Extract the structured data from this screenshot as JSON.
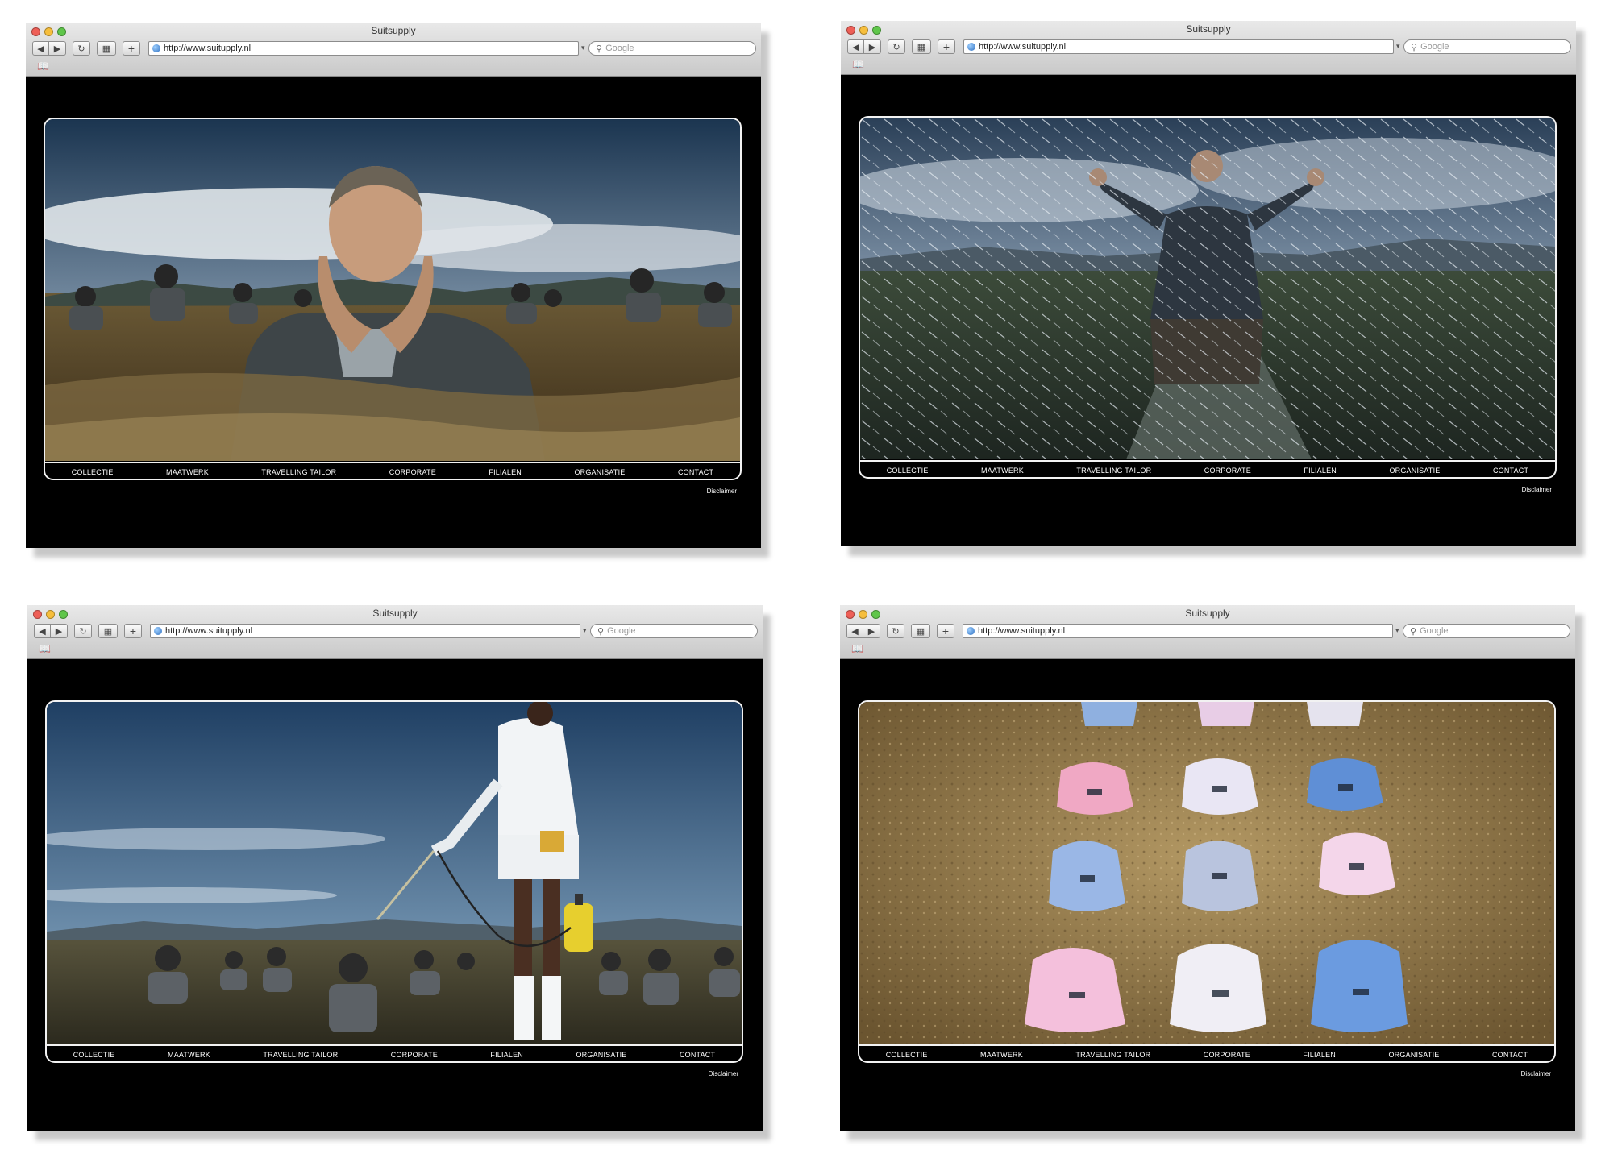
{
  "browser": {
    "title": "Suitsupply",
    "url": "http://www.suitupply.nl",
    "search_placeholder": "Google"
  },
  "site": {
    "nav": [
      "COLLECTIE",
      "MAATWERK",
      "TRAVELLING TAILOR",
      "CORPORATE",
      "FILIALEN",
      "ORGANISATIE",
      "CONTACT"
    ],
    "disclaimer": "Disclaimer"
  },
  "icons": {
    "back": "back-arrow-icon",
    "forward": "forward-arrow-icon",
    "reload": "reload-icon",
    "tabs": "tab-overview-icon",
    "add": "add-bookmark-icon",
    "bookmarks": "bookmarks-book-icon",
    "search": "magnifier-icon",
    "site": "globe-icon"
  },
  "colors": {
    "page_background": "#000000",
    "chrome": "#d6d6d6",
    "frame_border": "#f2f2f2",
    "nav_text": "#ffffff"
  },
  "windows": [
    {
      "photo": "man-buried-in-sand-hands-on-face"
    },
    {
      "photo": "man-kneeling-in-rain-arms-raised"
    },
    {
      "photo": "woman-spraying-buried-men"
    },
    {
      "photo": "shirt-collars-in-sand"
    }
  ]
}
